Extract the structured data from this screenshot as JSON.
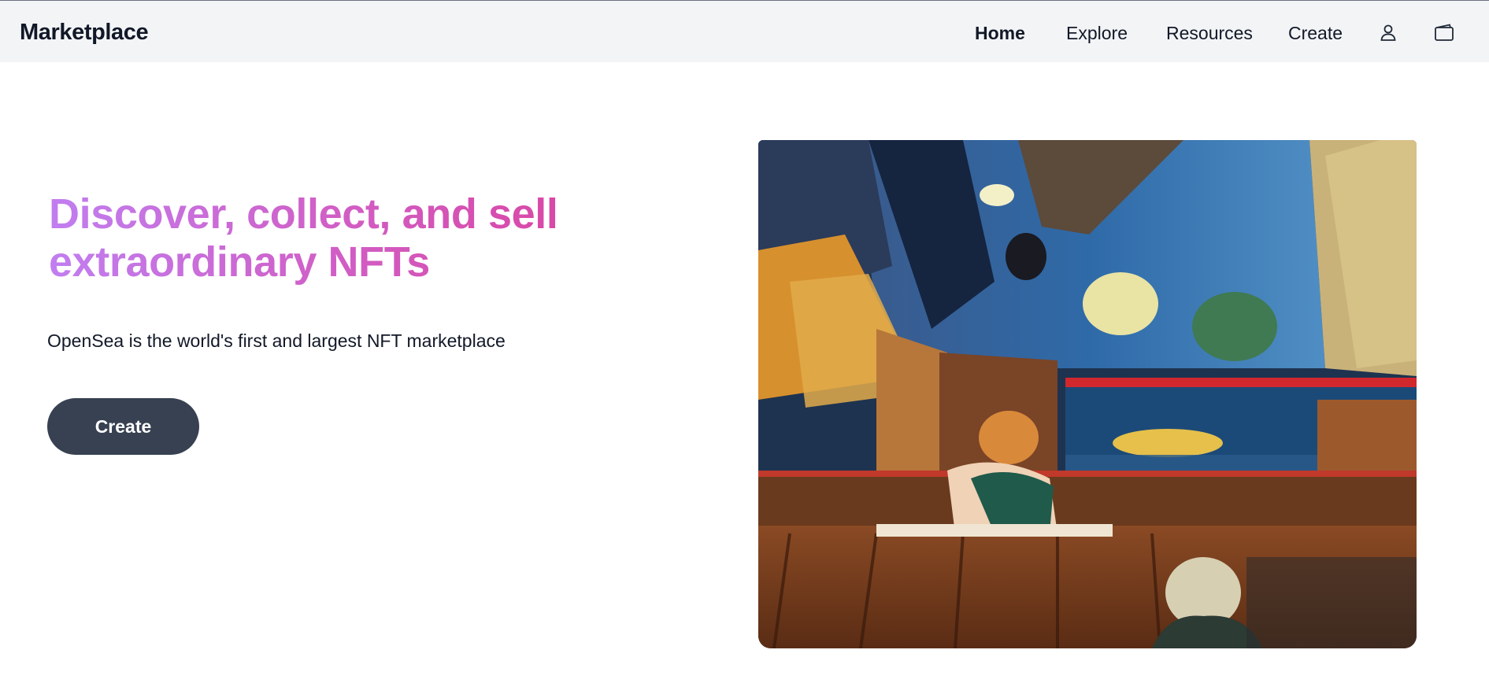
{
  "navbar": {
    "brand": "Marketplace",
    "links": [
      {
        "label": "Home",
        "active": true
      },
      {
        "label": "Explore",
        "active": false
      },
      {
        "label": "Resources",
        "active": false
      },
      {
        "label": "Create",
        "active": false
      }
    ],
    "icons": [
      "user-icon",
      "wallet-icon"
    ]
  },
  "hero": {
    "title": "Discover, collect, and sell extraordinary NFTs",
    "subtitle": "OpenSea is the world's first and largest NFT marketplace",
    "cta_label": "Create",
    "image_description_icon": "painting-image"
  },
  "colors": {
    "navbar_bg": "#f3f4f6",
    "title_gradient_start": "#c17ef0",
    "title_gradient_end": "#dc3f9a",
    "button_bg": "#374151",
    "button_text": "#ffffff"
  }
}
